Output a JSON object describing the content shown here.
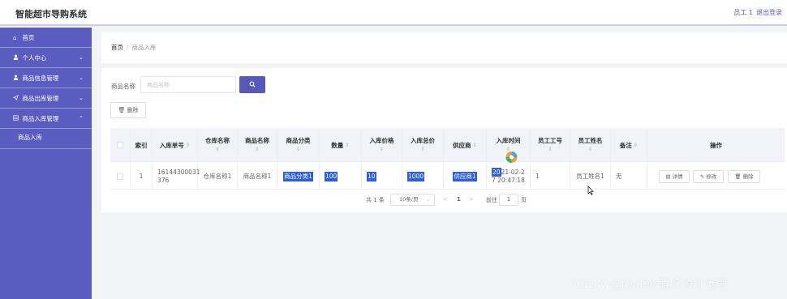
{
  "header": {
    "title": "智能超市导购系统",
    "user": "员工 1",
    "logout": "退出登录"
  },
  "sidebar": {
    "items": [
      {
        "label": "首页",
        "icon": "home-icon",
        "expanded": null
      },
      {
        "label": "个人中心",
        "icon": "user-icon",
        "expanded": false
      },
      {
        "label": "商品信息管理",
        "icon": "user-icon",
        "expanded": false
      },
      {
        "label": "商品出库管理",
        "icon": "send-icon",
        "expanded": false
      },
      {
        "label": "商品入库管理",
        "icon": "grid-icon",
        "expanded": true
      }
    ],
    "sub_items": [
      {
        "label": "商品入库"
      }
    ]
  },
  "breadcrumb": {
    "home": "首页",
    "separator": "/",
    "current": "商品入库"
  },
  "search": {
    "label": "商品名称",
    "placeholder": "商品名称",
    "button_icon": "search-icon"
  },
  "toolbar": {
    "delete_label": "删除"
  },
  "table": {
    "headers": {
      "index": "索引",
      "order_no": "入库单号",
      "warehouse": "仓库名称",
      "product": "商品名称",
      "category": "商品分类",
      "quantity": "数量",
      "price": "入库价格",
      "total": "入库总价",
      "supplier": "供应商",
      "time": "入库时间",
      "emp_no": "员工工号",
      "emp_name": "员工姓名",
      "remark": "备注",
      "actions": "操作"
    },
    "rows": [
      {
        "index": "1",
        "order_no_a": "16144300031",
        "order_no_b": "376",
        "warehouse": "仓库名称1",
        "product": "商品名称1",
        "category": "商品分类1",
        "quantity": "100",
        "price": "10",
        "total": "1000",
        "supplier": "供应商1",
        "time_hl": "20",
        "time_a": "21-02-2",
        "time_b": "7 20:47:18",
        "emp_no": "1",
        "emp_name": "员工姓名1",
        "remark": "无"
      }
    ],
    "row_actions": {
      "detail": "详情",
      "edit": "修改",
      "delete": "删除"
    }
  },
  "pagination": {
    "total": "共 1 条",
    "page_size": "10条/页",
    "prev": "<",
    "current": "1",
    "next": ">",
    "goto_label": "前往",
    "goto_value": "1",
    "page_suffix": "页"
  },
  "watermark": "CSDN @nodejs程序设计老哥",
  "colors": {
    "primary": "#5659b8",
    "sidebar": "#5a5cc0",
    "selection": "#2e5fd9"
  }
}
